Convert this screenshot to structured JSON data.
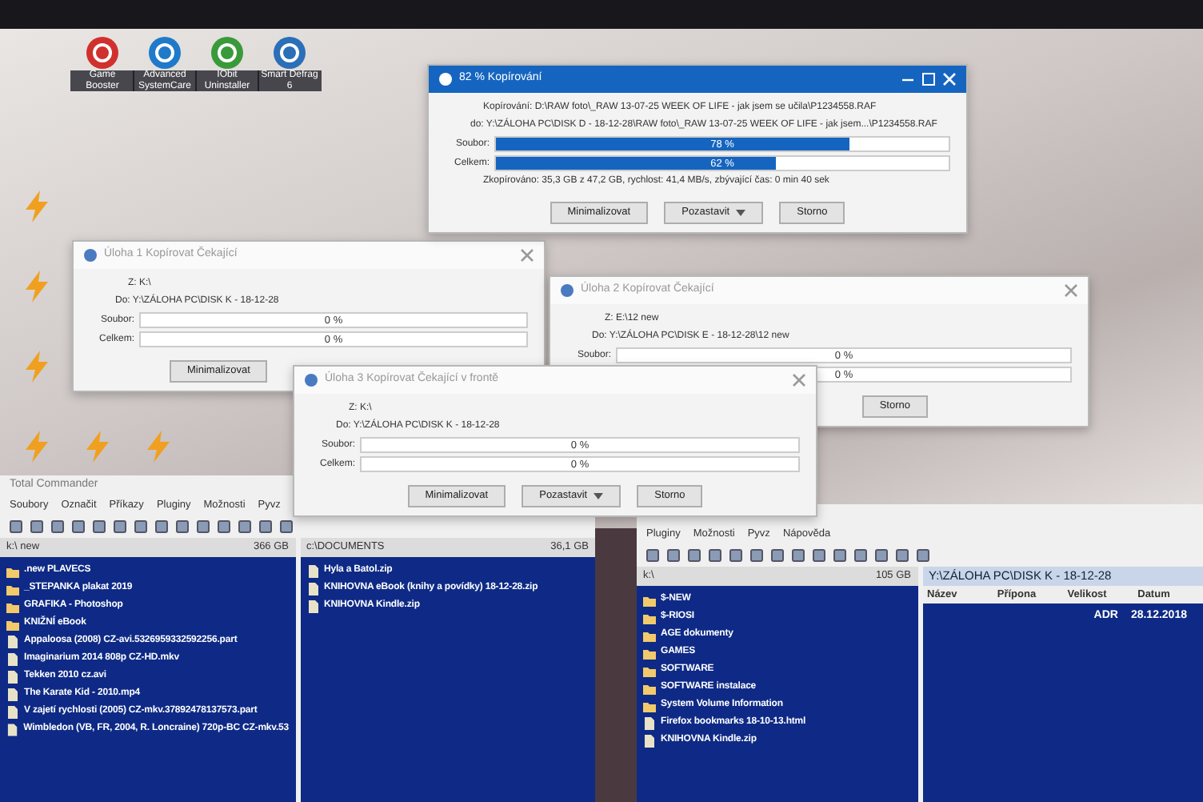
{
  "desktop_icons": [
    {
      "label": "Game Booster",
      "color": "#d0312d"
    },
    {
      "label": "Advanced SystemCare",
      "color": "#1f7ac9"
    },
    {
      "label": "IObit Uninstaller",
      "color": "#3a9a3a"
    },
    {
      "label": "Smart Defrag 6",
      "color": "#2a6fb8"
    }
  ],
  "shortcut_icons": [
    {
      "kind": "bolt"
    },
    {
      "kind": "bolt"
    },
    {
      "kind": "bolt"
    },
    {
      "kind": "bolt"
    },
    {
      "kind": "bolt"
    },
    {
      "kind": "bolt"
    }
  ],
  "file_managers": [
    {
      "title": "Total Commander",
      "menu": [
        "Soubory",
        "Označit",
        "Příkazy",
        "Pluginy",
        "Možnosti",
        "Pyvz"
      ],
      "panels": [
        {
          "drive": "k:\\ new",
          "free": "366 GB",
          "entries": [
            {
              "name": ".new PLAVECS",
              "kind": "folder"
            },
            {
              "name": "_STEPANKA plakat 2019",
              "kind": "folder"
            },
            {
              "name": "GRAFIKA - Photoshop",
              "kind": "folder"
            },
            {
              "name": "KNIŽNÍ eBook",
              "kind": "folder"
            },
            {
              "name": "Appaloosa (2008) CZ-avi.5326959332592256.part",
              "kind": "file"
            },
            {
              "name": "Imaginarium 2014 808p CZ-HD.mkv",
              "kind": "file"
            },
            {
              "name": "Tekken 2010 cz.avi",
              "kind": "file"
            },
            {
              "name": "The Karate Kid - 2010.mp4",
              "kind": "file"
            },
            {
              "name": "V zajetí rychlosti (2005) CZ-mkv.37892478137573.part",
              "kind": "file"
            },
            {
              "name": "Wimbledon (VB, FR, 2004, R. Loncraine) 720p-BC CZ-mkv.53",
              "kind": "file"
            }
          ]
        },
        {
          "drive": "c:\\DOCUMENTS",
          "free": "36,1 GB",
          "entries": [
            {
              "name": "Hyla a Batol.zip",
              "kind": "file"
            },
            {
              "name": "KNIHOVNA eBook (knihy a povídky) 18-12-28.zip",
              "kind": "file"
            },
            {
              "name": "KNIHOVNA Kindle.zip",
              "kind": "file"
            }
          ]
        }
      ]
    },
    {
      "menu": [
        "Pluginy",
        "Možnosti",
        "Pyvz",
        "Nápověda"
      ],
      "panels": [
        {
          "drive": "k:\\",
          "free": "105 GB",
          "entries": [
            {
              "name": "$-NEW",
              "kind": "folder"
            },
            {
              "name": "$-RIOSI",
              "kind": "folder"
            },
            {
              "name": "AGE dokumenty",
              "kind": "folder"
            },
            {
              "name": "GAMES",
              "kind": "folder"
            },
            {
              "name": "SOFTWARE",
              "kind": "folder"
            },
            {
              "name": "SOFTWARE instalace",
              "kind": "folder"
            },
            {
              "name": "System Volume Information",
              "kind": "folder"
            },
            {
              "name": "Firefox bookmarks 18-10-13.html",
              "kind": "file"
            },
            {
              "name": "KNIHOVNA Kindle.zip",
              "kind": "file"
            }
          ]
        },
        {
          "path": "Y:\\ZÁLOHA PC\\DISK K - 18-12-28",
          "columns": [
            "Název",
            "Přípona",
            "Velikost",
            "Datum"
          ],
          "rows": [
            {
              "size": "ADR",
              "date": "28.12.2018"
            }
          ]
        }
      ]
    }
  ],
  "dialogs": [
    {
      "title": "Úloha 1 Kopírovat Čekající",
      "active": false,
      "source": "Z: K:\\",
      "target": "Do: Y:\\ZÁLOHA PC\\DISK K - 18-12-28",
      "bars": [
        {
          "label": "Soubor:",
          "level": 0,
          "reading": "0 %"
        },
        {
          "label": "Celkem:",
          "level": 0,
          "reading": "0 %"
        }
      ],
      "buttons": [
        {
          "label": "Minimalizovat",
          "dropdown": false
        }
      ]
    },
    {
      "title": "Úloha 2 Kopírovat Čekající",
      "active": false,
      "source": "Z: E:\\12 new",
      "target": "Do: Y:\\ZÁLOHA PC\\DISK E - 18-12-28\\12 new",
      "bars": [
        {
          "label": "Soubor:",
          "level": 0,
          "reading": "0 %"
        },
        {
          "level": 0,
          "reading": "0 %"
        }
      ],
      "buttons": [
        {
          "label": "Storno",
          "dropdown": false
        }
      ]
    },
    {
      "title": "Úloha 3 Kopírovat Čekající v frontě",
      "active": false,
      "source": "Z: K:\\",
      "target": "Do: Y:\\ZÁLOHA PC\\DISK K - 18-12-28",
      "bars": [
        {
          "label": "Soubor:",
          "level": 0,
          "reading": "0 %"
        },
        {
          "label": "Celkem:",
          "level": 0,
          "reading": "0 %"
        }
      ],
      "buttons": [
        {
          "label": "Minimalizovat",
          "dropdown": false
        },
        {
          "label": "Pozastavit",
          "dropdown": true
        },
        {
          "label": "Storno",
          "dropdown": false
        }
      ]
    },
    {
      "title": "82 % Kopírování",
      "active": true,
      "source": "Kopírování: D:\\RAW foto\\_RAW 13-07-25 WEEK OF LIFE - jak jsem se učila\\P1234558.RAF",
      "target": "do: Y:\\ZÁLOHA PC\\DISK D - 18-12-28\\RAW foto\\_RAW 13-07-25 WEEK OF LIFE - jak jsem...\\P1234558.RAF",
      "bars": [
        {
          "label": "Soubor:",
          "level": 0.78,
          "reading": "78 %"
        },
        {
          "label": "Celkem:",
          "level": 0.62,
          "reading": "62 %"
        }
      ],
      "status": "Zkopírováno: 35,3 GB z 47,2 GB, rychlost: 41,4 MB/s, zbývající čas: 0 min 40 sek",
      "buttons": [
        {
          "label": "Minimalizovat",
          "dropdown": false
        },
        {
          "label": "Pozastavit",
          "dropdown": true
        },
        {
          "label": "Storno",
          "dropdown": false
        }
      ]
    }
  ]
}
